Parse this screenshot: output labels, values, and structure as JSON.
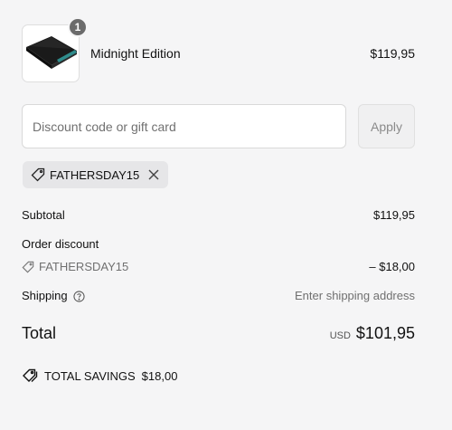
{
  "product": {
    "name": "Midnight Edition",
    "price": "$119,95",
    "quantity": "1"
  },
  "discount": {
    "placeholder": "Discount code or gift card",
    "value": "",
    "apply_label": "Apply",
    "applied_code": "FATHERSDAY15"
  },
  "summary": {
    "subtotal_label": "Subtotal",
    "subtotal_value": "$119,95",
    "order_discount_label": "Order discount",
    "discount_code": "FATHERSDAY15",
    "discount_value": "– $18,00",
    "shipping_label": "Shipping",
    "shipping_value": "Enter shipping address",
    "total_label": "Total",
    "total_currency": "USD",
    "total_value": "$101,95",
    "savings_label": "TOTAL SAVINGS",
    "savings_value": "$18,00"
  },
  "icons": {
    "tag": "tag-icon",
    "close": "close-icon",
    "help": "help-circle-icon",
    "savings": "savings-tags-icon"
  }
}
